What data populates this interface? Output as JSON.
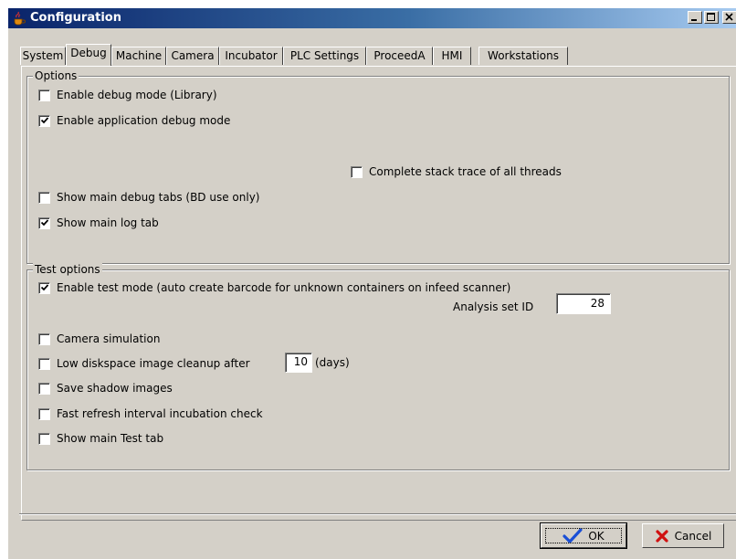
{
  "window": {
    "title": "Configuration",
    "buttons": [
      "minimize",
      "maximize",
      "close"
    ]
  },
  "tabs": [
    {
      "label": "System",
      "active": false
    },
    {
      "label": "Debug",
      "active": true
    },
    {
      "label": "Machine",
      "active": false
    },
    {
      "label": "Camera",
      "active": false
    },
    {
      "label": "Incubator",
      "active": false
    },
    {
      "label": "PLC Settings",
      "active": false
    },
    {
      "label": "ProceedA",
      "active": false
    },
    {
      "label": "HMI",
      "active": false
    },
    {
      "label": "Workstations",
      "active": false
    }
  ],
  "options": {
    "legend": "Options",
    "debug_library": {
      "label": "Enable debug mode (Library)",
      "checked": false
    },
    "app_debug": {
      "label": "Enable application debug mode",
      "checked": true
    },
    "stack_trace": {
      "label": "Complete stack trace of all threads",
      "checked": false
    },
    "debug_tabs": {
      "label": "Show main debug tabs (BD use only)",
      "checked": false
    },
    "log_tab": {
      "label": "Show main log tab",
      "checked": true
    }
  },
  "test_options": {
    "legend": "Test options",
    "test_mode": {
      "label": "Enable test mode (auto create barcode for unknown containers on infeed scanner)",
      "checked": true
    },
    "analysis_set_label": "Analysis set ID",
    "analysis_set_value": "28",
    "camera_sim": {
      "label": "Camera simulation",
      "checked": false
    },
    "cleanup": {
      "label": "Low diskspace image cleanup after",
      "checked": false
    },
    "cleanup_days_value": "10",
    "cleanup_days_unit": "(days)",
    "shadow_images": {
      "label": "Save shadow images",
      "checked": false
    },
    "fast_refresh": {
      "label": "Fast refresh interval incubation check",
      "checked": false
    },
    "test_tab": {
      "label": "Show main Test tab",
      "checked": false
    }
  },
  "footer": {
    "ok_label": "OK",
    "cancel_label": "Cancel"
  },
  "colors": {
    "titlebar_start": "#0a246a",
    "titlebar_end": "#a6caf0",
    "face": "#d4d0c8",
    "ok_check": "#1a4fd6",
    "cancel_x": "#d01010"
  }
}
